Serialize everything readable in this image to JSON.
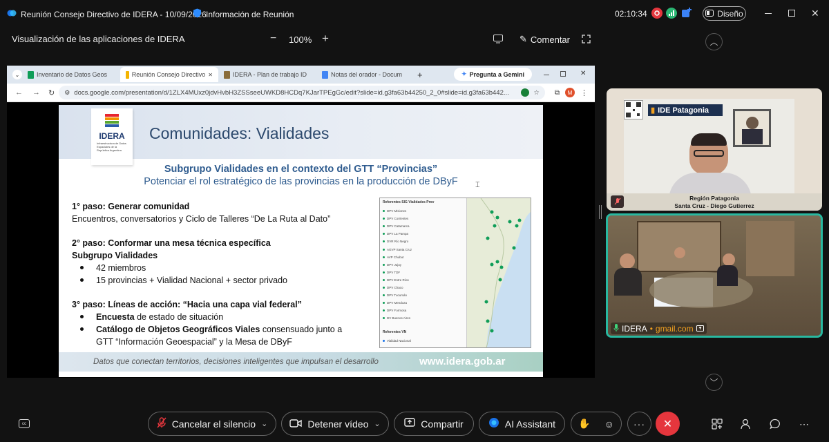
{
  "window": {
    "meeting_title": "Reunión Consejo Directivo de IDERA - 10/09/2026",
    "info_label": "Información de Reunión",
    "timer": "02:10:34",
    "layout_label": "Diseño"
  },
  "share": {
    "title": "Visualización de las aplicaciones de IDERA",
    "zoom": "100%",
    "comment_label": "Comentar"
  },
  "browser": {
    "tabs": [
      {
        "label": "Inventario de Datos Geos"
      },
      {
        "label": "Reunión Consejo Directivo"
      },
      {
        "label": "IDERA - Plan de trabajo ID"
      },
      {
        "label": "Notas del orador - Docum"
      }
    ],
    "gemini_label": "Pregunta a Gemini",
    "url": "docs.google.com/presentation/d/1ZLX4MUxz0jdvHvbH3ZSSseeUWKD8HCDq7KJarTPEgGc/edit?slide=id.g3fa63b44250_2_0#slide=id.g3fa63b442...",
    "profile_initial": "M"
  },
  "slide": {
    "logo_text": "IDERA",
    "logo_subtext": "Infraestructura de Datos Espaciales de la República Argentina",
    "title": "Comunidades: Vialidades",
    "subtitle1": "Subgrupo Vialidades en el contexto del GTT “Provincias”",
    "subtitle2": "Potenciar el rol estratégico de las provincias en la producción de DByF",
    "step1_title": "1° paso: Generar comunidad",
    "step1_text": "Encuentros, conversatorios y Ciclo de Talleres “De La Ruta al Dato”",
    "step2_title": "2° paso: Conformar una mesa técnica específica",
    "step2_sub": "Subgrupo Vialidades",
    "step2_bullets": [
      "42 miembros",
      "15 provincias + Vialidad Nacional + sector privado"
    ],
    "step3_title": "3° paso: Líneas de acción: “Hacia una capa vial federal”",
    "step3_b1_bold": "Encuesta",
    "step3_b1_rest": " de estado de situación",
    "step3_b2_bold": "Catálogo de Objetos Geográficos Viales",
    "step3_b2_rest": " consensuado junto a",
    "step3_b2_line2": "GTT “Información Geoespacial” y la Mesa de DByF",
    "footer_text": "Datos que conectan territorios, decisiones inteligentes que impulsan el desarrollo",
    "footer_url": "www.idera.gob.ar",
    "map": {
      "list_title": "Referentes SIG Vialidades Prov",
      "items": [
        "DPV Misiones",
        "DPV Corrientes",
        "DPV Catamarca",
        "DPV La Pampa",
        "DVR Río Negro",
        "AGVP Santa Cruz",
        "AVP Chubut",
        "DPV Jujuy",
        "DPV TDF",
        "DPV Entre Ríos",
        "DPV Chaco",
        "DPV Tucumán",
        "DPV Mendoza",
        "DPV Formosa",
        "DV Buenos Aires"
      ],
      "vn_title": "Referentes VN",
      "vn_items": [
        "Vialidad Nacional"
      ]
    }
  },
  "participants": {
    "patagonia": {
      "header": "IDE Patagonia",
      "caption1": "Región Patagonia",
      "caption2": "Santa Cruz - Diego Gutierrez"
    },
    "idera": {
      "name": "IDERA",
      "email_suffix": "gmail.com"
    }
  },
  "controls": {
    "unmute": "Cancelar el silencio",
    "stop_video": "Detener vídeo",
    "share": "Compartir",
    "ai": "AI Assistant"
  },
  "colors": {
    "accent_red": "#e5363d",
    "slide_title": "#2d4a6e",
    "subtitle_blue": "#2f5c8f",
    "green_border": "#28b8a0"
  }
}
